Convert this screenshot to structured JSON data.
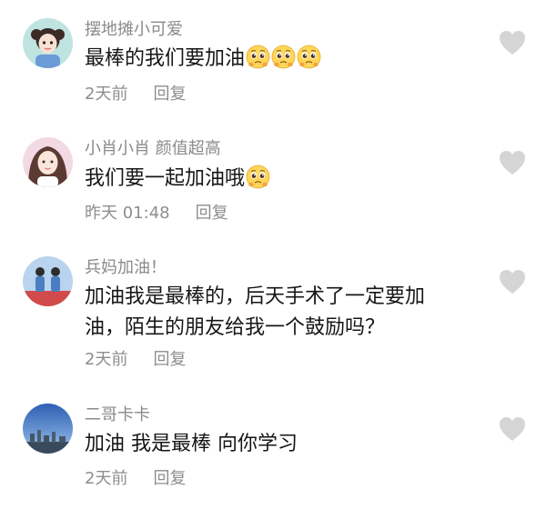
{
  "comments": [
    {
      "username": "摆地摊小可爱",
      "lines": [
        "最棒的我们要加油"
      ],
      "emoji_count": 3,
      "time": "2天前",
      "reply": "回复"
    },
    {
      "username": "小肖小肖 颜值超高",
      "lines": [
        "我们要一起加油哦"
      ],
      "emoji_count": 1,
      "time": "昨天 01:48",
      "reply": "回复"
    },
    {
      "username": "兵妈加油！",
      "lines": [
        "加油我是最棒的，后天手术了一定要加",
        "油，陌生的朋友给我一个鼓励吗？"
      ],
      "emoji_count": 0,
      "time": "2天前",
      "reply": "回复"
    },
    {
      "username": "二哥卡卡",
      "lines": [
        "加油 我是最棒 向你学习"
      ],
      "emoji_count": 0,
      "time": "2天前",
      "reply": "回复"
    }
  ],
  "icons": {
    "like": "heart-icon",
    "emoji": "pleading-face-emoji"
  },
  "colors": {
    "username": "#8a8a8a",
    "text": "#161616",
    "meta": "#8e8e8e",
    "heart": "#d5d5d5"
  }
}
